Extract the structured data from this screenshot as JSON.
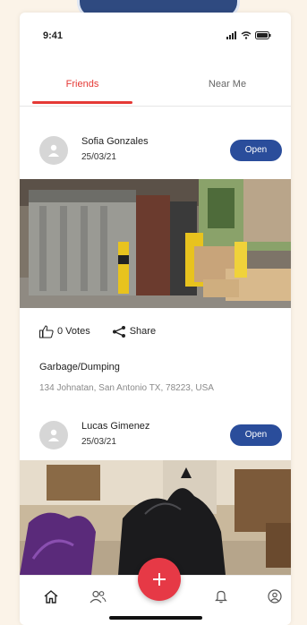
{
  "status_bar": {
    "time": "9:41"
  },
  "tabs": [
    {
      "label": "Friends",
      "active": true
    },
    {
      "label": "Near Me",
      "active": false
    }
  ],
  "posts": [
    {
      "author": "Sofia Gonzales",
      "date": "25/03/21",
      "open_label": "Open",
      "votes_label": "0 Votes",
      "share_label": "Share",
      "category": "Garbage/Dumping",
      "address": "134 Johnatan, San Antonio TX, 78223, USA"
    },
    {
      "author": "Lucas Gimenez",
      "date": "25/03/21",
      "open_label": "Open"
    }
  ],
  "bottom_nav": {
    "items": [
      {
        "icon": "home-icon"
      },
      {
        "icon": "people-icon"
      },
      {
        "icon": "plus-icon"
      },
      {
        "icon": "bell-icon"
      },
      {
        "icon": "profile-icon"
      }
    ]
  },
  "colors": {
    "accent_red": "#e53935",
    "button_blue": "#2a4d9b",
    "background": "#fbf3e8"
  }
}
